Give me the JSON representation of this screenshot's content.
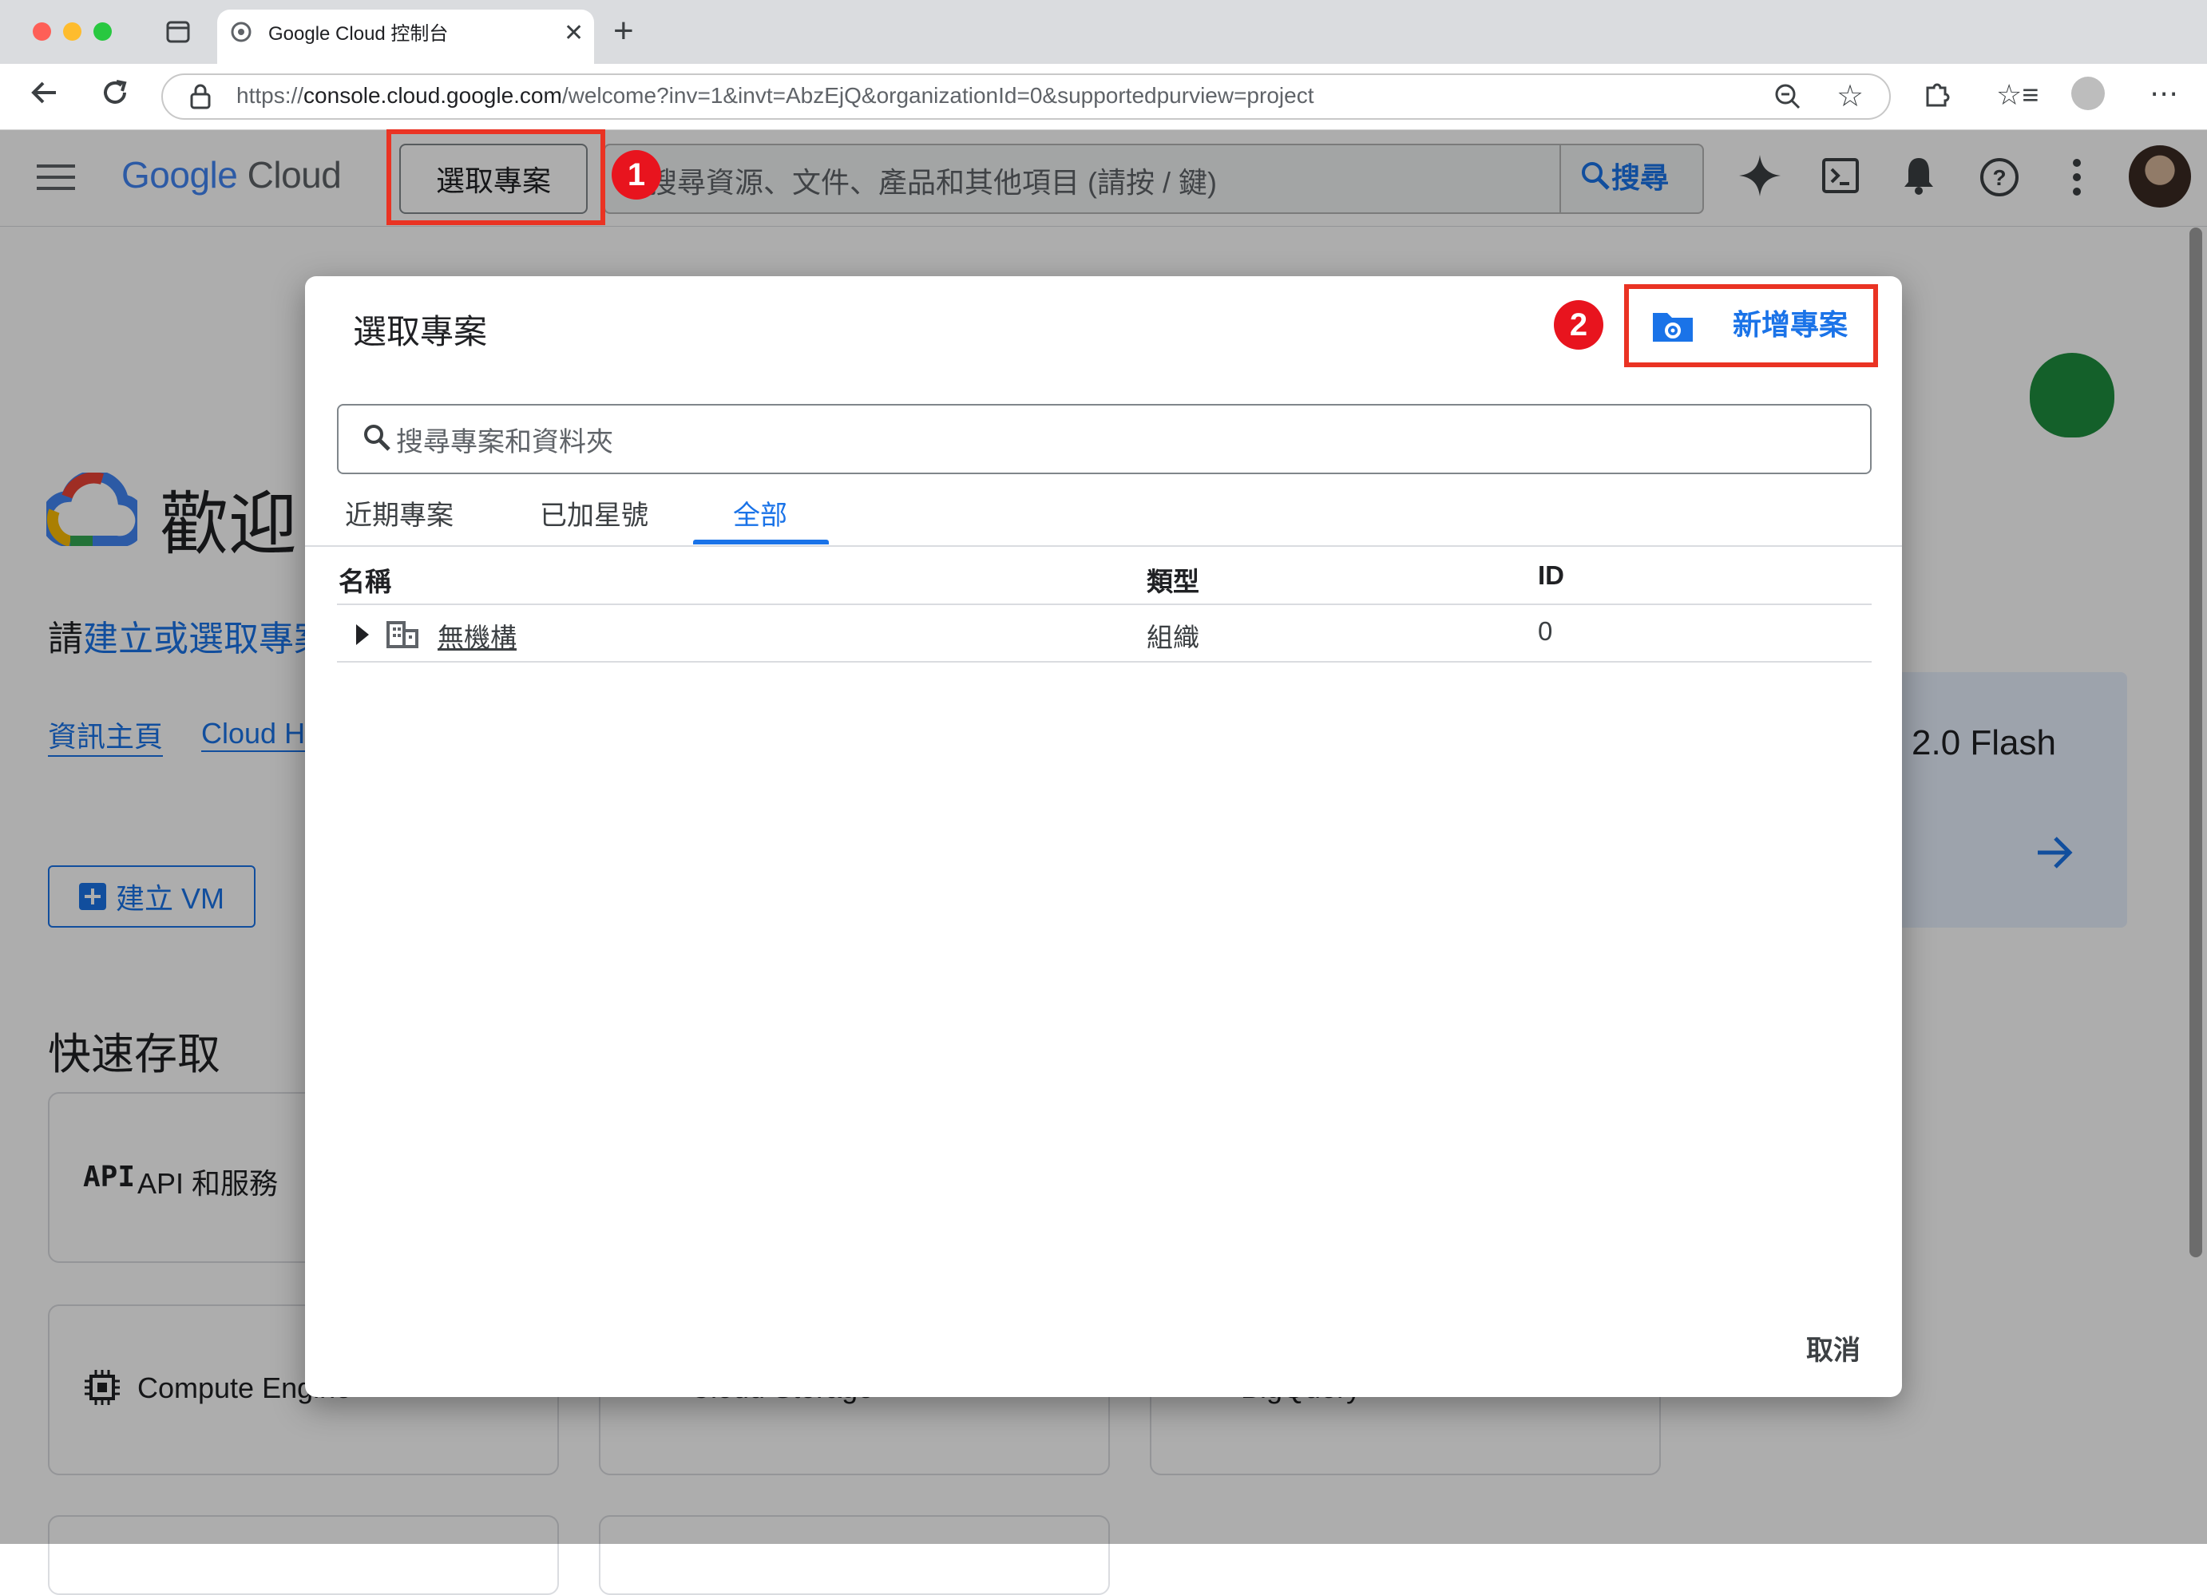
{
  "browser": {
    "tab_title": "Google Cloud 控制台",
    "url_prefix": "https://",
    "url_host": "console.cloud.google.com",
    "url_path": "/welcome?inv=1&invt=AbzEjQ&organizationId=0&supportedpurview=project"
  },
  "header": {
    "logo_google": "Google",
    "logo_cloud": "Cloud",
    "project_picker_label": "選取專案",
    "search_placeholder": "搜尋資源、文件、產品和其他項目 (請按 / 鍵)",
    "search_button": "搜尋"
  },
  "page": {
    "welcome_title": "歡迎",
    "prompt_prefix": "請",
    "prompt_link": "建立或選取專案",
    "links": [
      "資訊主頁",
      "Cloud H"
    ],
    "create_vm": "建立 VM",
    "quick_access_title": "快速存取",
    "api_badge": "API",
    "api_label": "API 和服務",
    "compute_label": "Compute Engine",
    "storage_label": "Cloud Storage",
    "bigquery_label": "BigQuery",
    "gemini_card_text": "2.0 Flash"
  },
  "dialog": {
    "title": "選取專案",
    "new_project": "新增專案",
    "search_placeholder": "搜尋專案和資料夾",
    "tabs": [
      "近期專案",
      "已加星號",
      "全部"
    ],
    "active_tab": "全部",
    "columns": [
      "名稱",
      "類型",
      "ID"
    ],
    "rows": [
      {
        "name": "無機構",
        "type": "組織",
        "id": "0"
      }
    ],
    "cancel": "取消"
  },
  "annotations": {
    "badge_1": "1",
    "badge_2": "2",
    "color": "#ea3323"
  },
  "colors": {
    "accent": "#1a73e8",
    "annotation_red": "#ea3323"
  }
}
